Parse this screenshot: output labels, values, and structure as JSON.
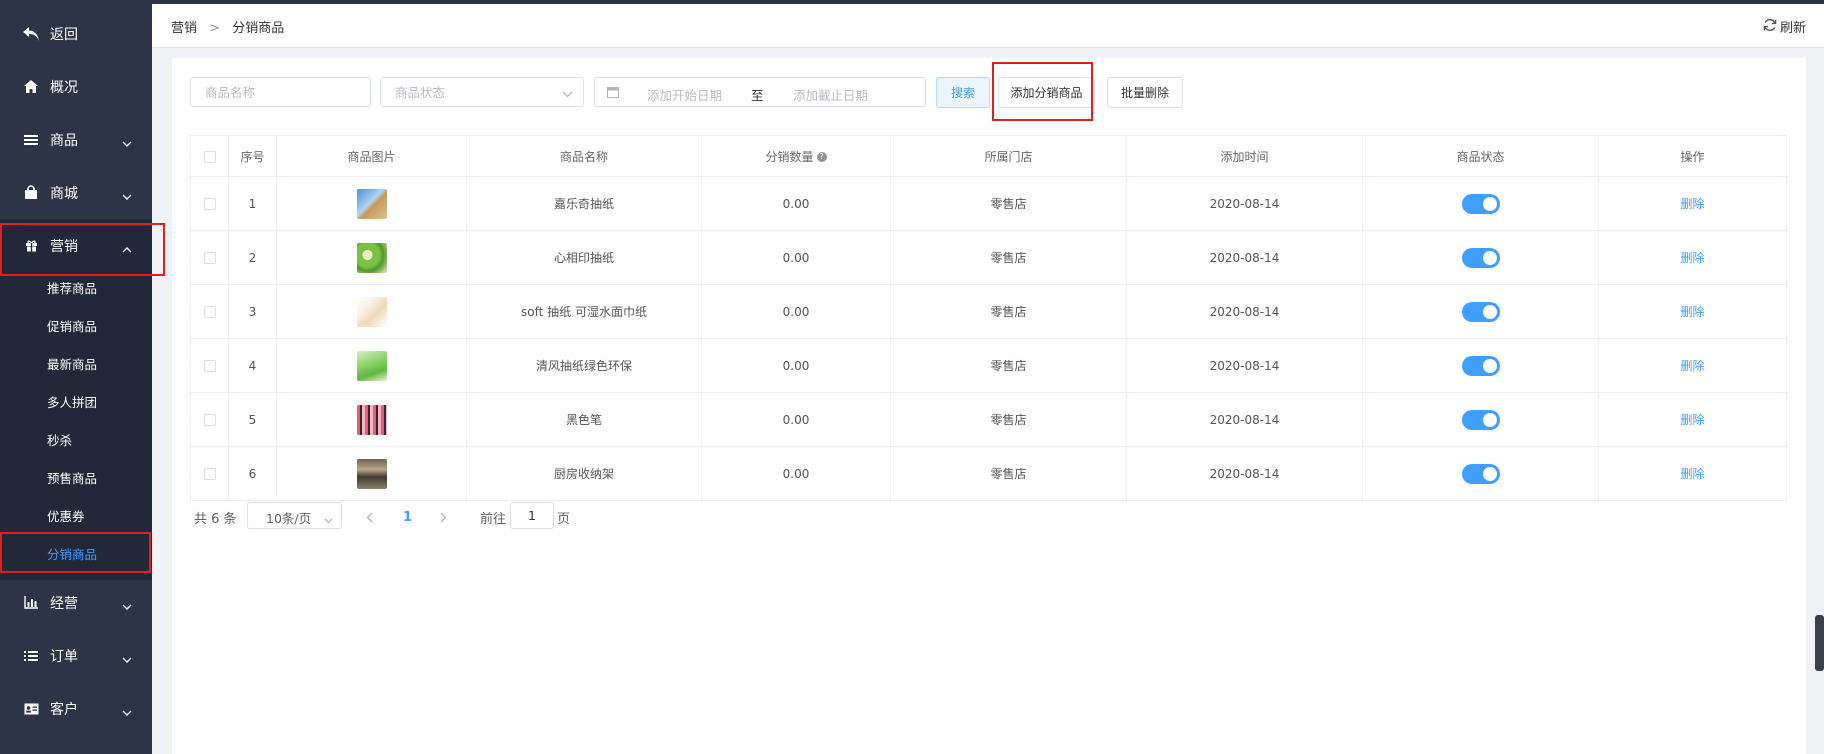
{
  "sidebar": {
    "back": "返回",
    "overview": "概况",
    "goods": "商品",
    "mall": "商城",
    "marketing": "营销",
    "submenu": [
      "推荐商品",
      "促销商品",
      "最新商品",
      "多人拼团",
      "秒杀",
      "预售商品",
      "优惠券",
      "分销商品"
    ],
    "operations": "经营",
    "orders": "订单",
    "customers": "客户"
  },
  "topbar": {
    "crumb_parent": "营销",
    "crumb_current": "分销商品",
    "refresh": "刷新"
  },
  "filters": {
    "name_placeholder": "商品名称",
    "status_placeholder": "商品状态",
    "start_date": "添加开始日期",
    "to": "至",
    "end_date": "添加截止日期",
    "search": "搜索",
    "add": "添加分销商品",
    "batch_delete": "批量删除"
  },
  "table": {
    "headers": [
      "序号",
      "商品图片",
      "商品名称",
      "分销数量",
      "所属门店",
      "添加时间",
      "商品状态",
      "操作"
    ],
    "rows": [
      {
        "no": "1",
        "name": "嘉乐奇抽纸",
        "qty": "0.00",
        "store": "零售店",
        "date": "2020-08-14",
        "action": "删除",
        "enabled": true
      },
      {
        "no": "2",
        "name": "心相印抽纸",
        "qty": "0.00",
        "store": "零售店",
        "date": "2020-08-14",
        "action": "删除",
        "enabled": true
      },
      {
        "no": "3",
        "name": "soft 抽纸 可湿水面巾纸",
        "qty": "0.00",
        "store": "零售店",
        "date": "2020-08-14",
        "action": "删除",
        "enabled": true
      },
      {
        "no": "4",
        "name": "清风抽纸绿色环保",
        "qty": "0.00",
        "store": "零售店",
        "date": "2020-08-14",
        "action": "删除",
        "enabled": true
      },
      {
        "no": "5",
        "name": "黑色笔",
        "qty": "0.00",
        "store": "零售店",
        "date": "2020-08-14",
        "action": "删除",
        "enabled": true
      },
      {
        "no": "6",
        "name": "厨房收纳架",
        "qty": "0.00",
        "store": "零售店",
        "date": "2020-08-14",
        "action": "删除",
        "enabled": true
      }
    ]
  },
  "pagination": {
    "total": "共 6 条",
    "page_size": "10条/页",
    "current": "1",
    "goto": "前往",
    "goto_value": "1",
    "page_unit": "页"
  },
  "colors": {
    "sidebar_bg": "#2d3446",
    "accent": "#409eff",
    "highlight": "#e02020"
  }
}
